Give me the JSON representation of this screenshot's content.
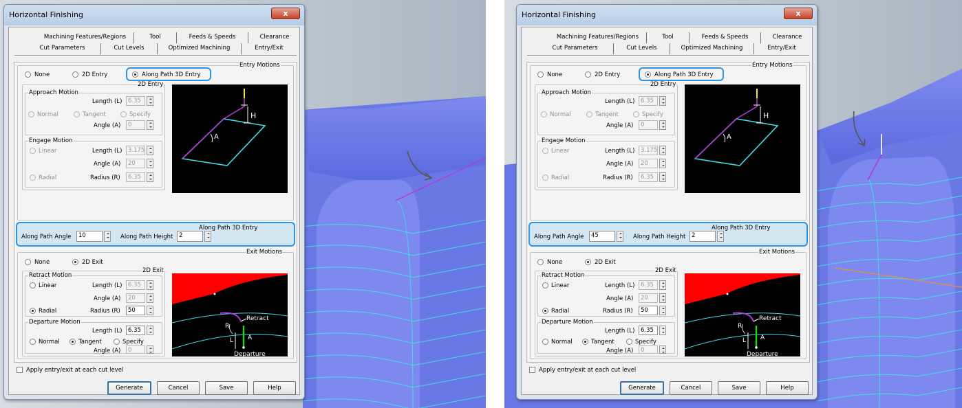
{
  "panels": [
    {
      "title": "Horizontal Finishing",
      "close_label": "x",
      "tabs_row1": [
        "Machining Features/Regions",
        "Tool",
        "Feeds & Speeds",
        "Clearance"
      ],
      "tabs_row2": [
        "Cut Parameters",
        "Cut Levels",
        "Optimized Machining",
        "Entry/Exit"
      ],
      "entry_group": "Entry Motions",
      "entry_options": [
        "None",
        "2D Entry",
        "Along Path 3D Entry"
      ],
      "entry_2d_group": "2D Entry",
      "approach_group": "Approach Motion",
      "length_l_label": "Length (L)",
      "approach_length": "6.35",
      "approach_options": [
        "Normal",
        "Tangent",
        "Specify"
      ],
      "angle_a_label": "Angle (A)",
      "approach_angle": "0",
      "engage_group": "Engage Motion",
      "engage_linear": "Linear",
      "engage_length": "3.175",
      "engage_angle": "20",
      "engage_radial": "Radial",
      "radius_r_label": "Radius (R)",
      "engage_radius": "6.35",
      "along_group": "Along Path 3D Entry",
      "along_angle_label": "Along Path Angle",
      "along_angle_value": "10",
      "along_height_label": "Along Path Height",
      "along_height_value": "2",
      "exit_group": "Exit Motions",
      "exit_options": [
        "None",
        "2D Exit"
      ],
      "exit_2d_group": "2D Exit",
      "retract_group": "Retract Motion",
      "retract_linear": "Linear",
      "retract_length": "6.35",
      "retract_angle": "20",
      "retract_radial": "Radial",
      "retract_radius": "50",
      "departure_group": "Departure Motion",
      "departure_length": "6.35",
      "departure_options": [
        "Normal",
        "Tangent",
        "Specify"
      ],
      "departure_angle": "0",
      "diagram_entry": {
        "H": "H",
        "A": "A"
      },
      "diagram_exit": {
        "retract": "Retract",
        "departure": "Departure",
        "R": "R",
        "A": "A",
        "L": "L"
      },
      "apply_checkbox": "Apply entry/exit at each cut level",
      "buttons": [
        "Generate",
        "Cancel",
        "Save",
        "Help"
      ]
    },
    {
      "title": "Horizontal Finishing",
      "close_label": "x",
      "tabs_row1": [
        "Machining Features/Regions",
        "Tool",
        "Feeds & Speeds",
        "Clearance"
      ],
      "tabs_row2": [
        "Cut Parameters",
        "Cut Levels",
        "Optimized Machining",
        "Entry/Exit"
      ],
      "entry_group": "Entry Motions",
      "entry_options": [
        "None",
        "2D Entry",
        "Along Path 3D Entry"
      ],
      "entry_2d_group": "2D Entry",
      "approach_group": "Approach Motion",
      "length_l_label": "Length (L)",
      "approach_length": "6.35",
      "approach_options": [
        "Normal",
        "Tangent",
        "Specify"
      ],
      "angle_a_label": "Angle (A)",
      "approach_angle": "0",
      "engage_group": "Engage Motion",
      "engage_linear": "Linear",
      "engage_length": "3.175",
      "engage_angle": "20",
      "engage_radial": "Radial",
      "radius_r_label": "Radius (R)",
      "engage_radius": "6.35",
      "along_group": "Along Path 3D Entry",
      "along_angle_label": "Along Path Angle",
      "along_angle_value": "45",
      "along_height_label": "Along Path Height",
      "along_height_value": "2",
      "exit_group": "Exit Motions",
      "exit_options": [
        "None",
        "2D Exit"
      ],
      "exit_2d_group": "2D Exit",
      "retract_group": "Retract Motion",
      "retract_linear": "Linear",
      "retract_length": "6.35",
      "retract_angle": "20",
      "retract_radial": "Radial",
      "retract_radius": "50",
      "departure_group": "Departure Motion",
      "departure_length": "6.35",
      "departure_options": [
        "Normal",
        "Tangent",
        "Specify"
      ],
      "departure_angle": "0",
      "diagram_entry": {
        "H": "H",
        "A": "A"
      },
      "diagram_exit": {
        "retract": "Retract",
        "departure": "Departure",
        "R": "R",
        "A": "A",
        "L": "L"
      },
      "apply_checkbox": "Apply entry/exit at each cut level",
      "buttons": [
        "Generate",
        "Cancel",
        "Save",
        "Help"
      ]
    }
  ],
  "colors": {
    "viewport_bg": "#c9d1d8",
    "part": "#6a78e6",
    "toolpath": "#41dde6",
    "highlight": "#2c94e6",
    "entry_path": "#b13ad3"
  }
}
